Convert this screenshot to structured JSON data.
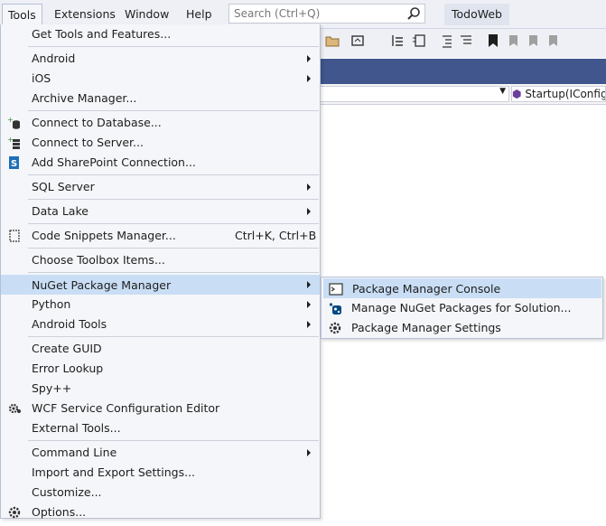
{
  "menubar": {
    "items": [
      "Tools",
      "Extensions",
      "Window",
      "Help"
    ],
    "search_placeholder": "Search (Ctrl+Q)",
    "solution_name": "TodoWeb"
  },
  "navbar": {
    "member_text": "Startup(IConfig"
  },
  "tools_menu": {
    "items": [
      {
        "label": "Get Tools and Features..."
      },
      {
        "label": "Android",
        "submenu": true
      },
      {
        "label": "iOS",
        "submenu": true
      },
      {
        "label": "Archive Manager..."
      },
      {
        "label": "Connect to Database...",
        "icon": "database-icon"
      },
      {
        "label": "Connect to Server...",
        "icon": "server-icon"
      },
      {
        "label": "Add SharePoint Connection...",
        "icon": "sharepoint-icon"
      },
      {
        "label": "SQL Server",
        "submenu": true
      },
      {
        "label": "Data Lake",
        "submenu": true
      },
      {
        "label": "Code Snippets Manager...",
        "shortcut": "Ctrl+K, Ctrl+B",
        "icon": "snippet-icon"
      },
      {
        "label": "Choose Toolbox Items..."
      },
      {
        "label": "NuGet Package Manager",
        "submenu": true,
        "highlighted": true
      },
      {
        "label": "Python",
        "submenu": true
      },
      {
        "label": "Android Tools",
        "submenu": true
      },
      {
        "label": "Create GUID"
      },
      {
        "label": "Error Lookup"
      },
      {
        "label": "Spy++"
      },
      {
        "label": "WCF Service Configuration Editor",
        "icon": "wcf-config-icon"
      },
      {
        "label": "External Tools..."
      },
      {
        "label": "Command Line",
        "submenu": true
      },
      {
        "label": "Import and Export Settings..."
      },
      {
        "label": "Customize..."
      },
      {
        "label": "Options...",
        "icon": "gear-icon"
      }
    ]
  },
  "nuget_submenu": {
    "items": [
      {
        "label": "Package Manager Console",
        "icon": "console-icon",
        "highlighted": true
      },
      {
        "label": "Manage NuGet Packages for Solution...",
        "icon": "nuget-icon"
      },
      {
        "label": "Package Manager Settings",
        "icon": "gear-icon"
      }
    ]
  },
  "colors": {
    "highlight": "#c9def5",
    "tabstrip": "#40568d",
    "menu_bg": "#f5f6f9"
  }
}
